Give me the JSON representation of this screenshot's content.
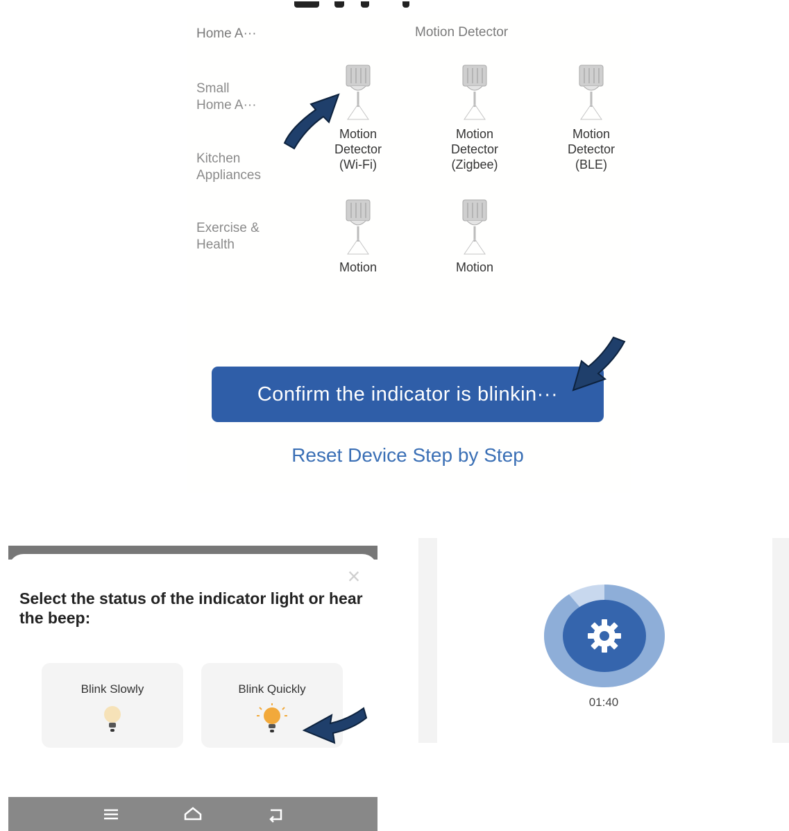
{
  "device_list": {
    "cut_top_left": "Home A···",
    "cut_top_right": "Motion Detector",
    "categories": [
      "Small\nHome A···",
      "Kitchen\nAppliances",
      "Exercise &\nHealth"
    ],
    "tiles_row1": [
      {
        "label": "Motion\nDetector\n(Wi-Fi)"
      },
      {
        "label": "Motion\nDetector\n(Zigbee)"
      },
      {
        "label": "Motion\nDetector\n(BLE)"
      }
    ],
    "tiles_row2": [
      {
        "label": "Motion"
      },
      {
        "label": "Motion"
      }
    ],
    "confirm_button": "Confirm the indicator is blinkin···",
    "reset_link": "Reset Device Step by Step"
  },
  "indicator_sheet": {
    "title": "Select the status of the indicator light or hear the beep:",
    "close_icon": "close-icon",
    "options": [
      {
        "label": "Blink Slowly",
        "icon": "bulb-dim-icon"
      },
      {
        "label": "Blink Quickly",
        "icon": "bulb-bright-icon"
      }
    ],
    "nav_icons": [
      "menu-icon",
      "home-icon",
      "back-icon"
    ]
  },
  "progress": {
    "icon": "gear-icon",
    "timer": "01:40",
    "fraction": 0.9
  },
  "colors": {
    "accent": "#2f5ea8",
    "link": "#3a6fb5",
    "arrow": "#1f3f6b",
    "ring_light": "#b9cde8",
    "ring_mid": "#8eaed8",
    "bulb_bright": "#f2a93b",
    "bulb_dim": "#f6e2b8"
  }
}
